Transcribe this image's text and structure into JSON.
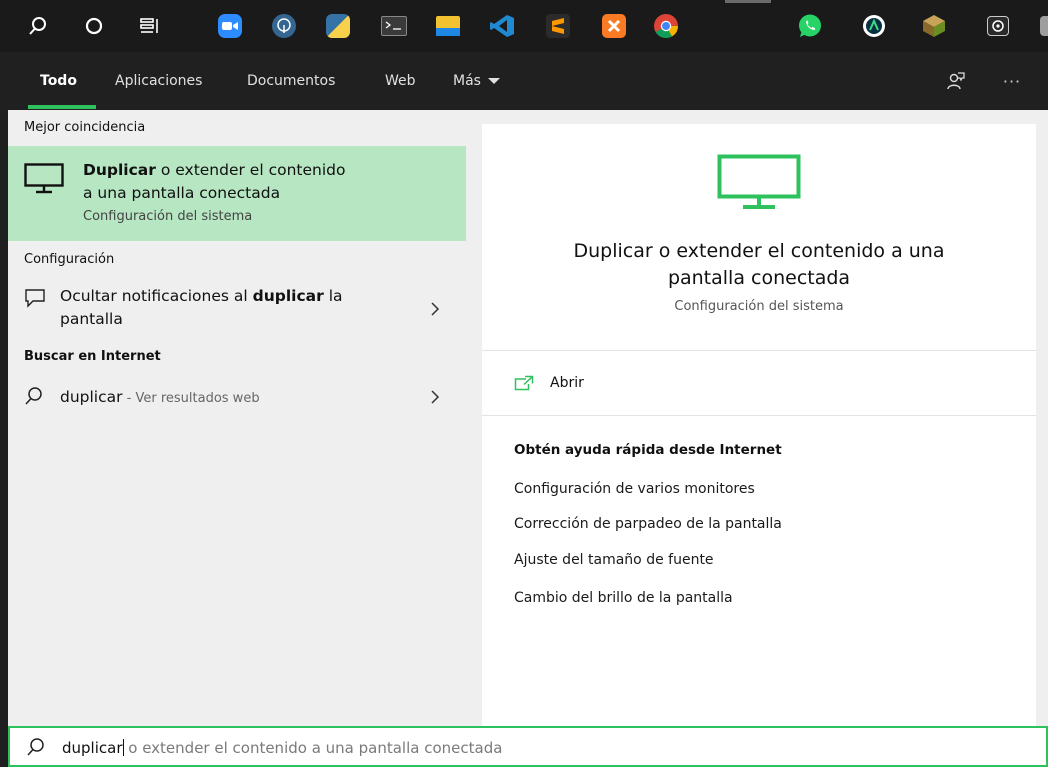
{
  "taskbar": {
    "items": [
      {
        "name": "search-icon"
      },
      {
        "name": "cortana-icon"
      },
      {
        "name": "task-view-icon"
      },
      {
        "name": "zoom-icon",
        "color": "#2d8cff"
      },
      {
        "name": "postgresql-icon",
        "color": "#336791"
      },
      {
        "name": "python-icon",
        "color": "#3572a5"
      },
      {
        "name": "terminal-icon",
        "color": "#3a3a3a"
      },
      {
        "name": "file-explorer-icon",
        "color": "#f2c230"
      },
      {
        "name": "vscode-icon",
        "color": "#1f8ad2"
      },
      {
        "name": "sublime-text-icon",
        "color": "#ff9800"
      },
      {
        "name": "xampp-icon",
        "color": "#fb7a24"
      },
      {
        "name": "chrome-icon",
        "color": "#4caf50"
      },
      {
        "name": "whatsapp-icon",
        "color": "#25d366"
      },
      {
        "name": "android-studio-icon",
        "color": "#3ddc84"
      },
      {
        "name": "package-icon",
        "color": "#8bc34a"
      },
      {
        "name": "obs-icon",
        "color": "#e0e0e0"
      }
    ]
  },
  "tabs": [
    {
      "label": "Todo",
      "active": true
    },
    {
      "label": "Aplicaciones"
    },
    {
      "label": "Documentos"
    },
    {
      "label": "Web"
    },
    {
      "label": "Más"
    }
  ],
  "header_buttons": {
    "feedback": "feedback-icon",
    "more": "···"
  },
  "left": {
    "best_match_heading": "Mejor coincidencia",
    "best_match": {
      "title_bold": "Duplicar",
      "title_rest": " o extender el contenido",
      "title_line2": "a una pantalla conectada",
      "subtitle": "Configuración del sistema"
    },
    "settings_heading": "Configuración",
    "settings_item": {
      "prefix": "Ocultar notificaciones al ",
      "bold": "duplicar",
      "suffix": " la",
      "line2": "pantalla"
    },
    "web_heading": "Buscar en Internet",
    "web_item": {
      "term": "duplicar",
      "suffix": " - Ver resultados web"
    }
  },
  "preview": {
    "title_line1": "Duplicar o extender el contenido a una",
    "title_line2": "pantalla conectada",
    "subtitle": "Configuración del sistema",
    "open_label": "Abrir",
    "help_heading": "Obtén ayuda rápida desde Internet",
    "help_links": [
      "Configuración de varios monitores",
      "Corrección de parpadeo de la pantalla",
      "Ajuste del tamaño de fuente",
      "Cambio del brillo de la pantalla"
    ]
  },
  "search": {
    "typed": "duplicar",
    "suggestion": " o extender el contenido a una pantalla conectada"
  },
  "colors": {
    "accent": "#2ec25e",
    "selected_row": "#b6e6c2"
  }
}
